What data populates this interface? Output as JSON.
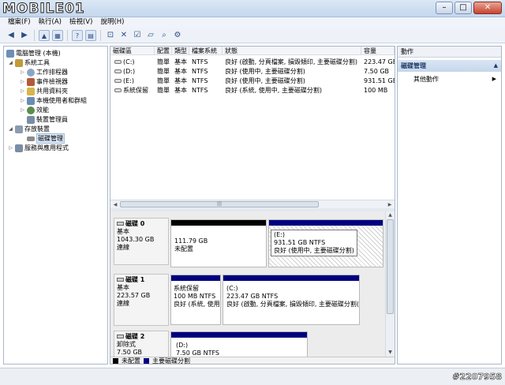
{
  "brand": {
    "logo_text": "MOBILE01"
  },
  "window": {
    "minimize": "–",
    "maximize": "□",
    "close": "✕"
  },
  "menu": [
    "檔案(F)",
    "執行(A)",
    "檢視(V)",
    "說明(H)"
  ],
  "tree": [
    {
      "label": "電腦管理 (本機)",
      "icon": "computer-icon",
      "color": "#6d8fb7"
    },
    {
      "label": "系統工具",
      "icon": "tools-icon",
      "color": "#c29a3a"
    },
    {
      "label": "工作排程器",
      "icon": "clock-icon",
      "color": "#8aa4c6"
    },
    {
      "label": "事件檢視器",
      "icon": "event-viewer-icon",
      "color": "#b35a3a"
    },
    {
      "label": "共用資料夾",
      "icon": "shared-folder-icon",
      "color": "#d8b44a"
    },
    {
      "label": "本機使用者和群組",
      "icon": "users-icon",
      "color": "#6b8cb5"
    },
    {
      "label": "效能",
      "icon": "performance-icon",
      "color": "#5a8e4a"
    },
    {
      "label": "裝置管理員",
      "icon": "device-manager-icon",
      "color": "#7a8da6"
    },
    {
      "label": "存放裝置",
      "icon": "storage-icon",
      "color": "#8a9bb0"
    },
    {
      "label": "磁碟管理",
      "icon": "disk-management-icon",
      "color": "#8b8b8b"
    },
    {
      "label": "服務與應用程式",
      "icon": "services-icon",
      "color": "#7a8da6"
    }
  ],
  "volume_table": {
    "headers": [
      "磁碟區",
      "配置",
      "類型",
      "檔案系統",
      "狀態",
      "容量"
    ],
    "rows": [
      [
        "(C:)",
        "簡單",
        "基本",
        "NTFS",
        "良好 (啟動, 分頁檔案, 損毀傾印, 主要磁碟分割)",
        "223.47 GB"
      ],
      [
        "(D:)",
        "簡單",
        "基本",
        "NTFS",
        "良好 (使用中, 主要磁碟分割)",
        "7.50 GB"
      ],
      [
        "(E:)",
        "簡單",
        "基本",
        "NTFS",
        "良好 (使用中, 主要磁碟分割)",
        "931.51 GB"
      ],
      [
        "系統保留",
        "簡單",
        "基本",
        "NTFS",
        "良好 (系統, 使用中, 主要磁碟分割)",
        "100 MB"
      ]
    ]
  },
  "disks": [
    {
      "name": "磁碟 0",
      "type": "基本",
      "size": "1043.30 GB",
      "status": "連線",
      "partitions": [
        {
          "name": "",
          "size": "111.79 GB",
          "fs": "",
          "status": "未配置",
          "style": "unallocated"
        },
        {
          "name": "(E:)",
          "size": "931.51 GB NTFS",
          "fs": "",
          "status": "良好 (使用中, 主要磁碟分割)",
          "style": "selected"
        }
      ]
    },
    {
      "name": "磁碟 1",
      "type": "基本",
      "size": "223.57 GB",
      "status": "連線",
      "partitions": [
        {
          "name": "系統保留",
          "size": "100 MB NTFS",
          "fs": "",
          "status": "良好 (系統, 使用",
          "style": "primary"
        },
        {
          "name": "(C:)",
          "size": "223.47 GB NTFS",
          "fs": "",
          "status": "良好 (啟動, 分頁檔案, 損毀傾印, 主要磁碟分割(",
          "style": "primary"
        }
      ]
    },
    {
      "name": "磁碟 2",
      "type": "卸除式",
      "size": "7.50 GB",
      "status": "",
      "partitions": [
        {
          "name": "(D:)",
          "size": "7.50 GB NTFS",
          "fs": "",
          "status": "",
          "style": "primary"
        }
      ]
    }
  ],
  "legend": [
    {
      "label": "未配置",
      "color": "#000000"
    },
    {
      "label": "主要磁碟分割",
      "color": "#000080"
    }
  ],
  "actions": {
    "header": "動作",
    "section": "磁碟管理",
    "more": "其他動作"
  },
  "watermark": "#2207958",
  "colors": {
    "primary_partition": "#000080",
    "unallocated": "#000000",
    "selection": "#dce9f7"
  }
}
